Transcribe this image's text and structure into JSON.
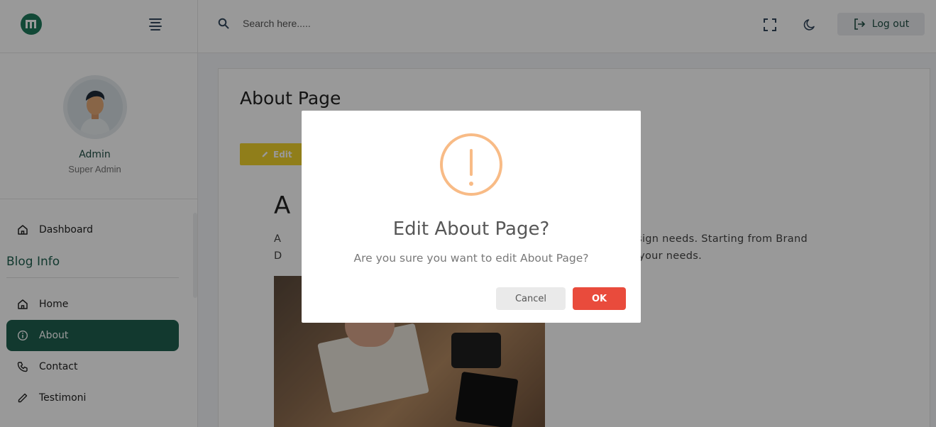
{
  "header": {
    "search_placeholder": "Search here.....",
    "logout_label": "Log out"
  },
  "sidebar": {
    "user_name": "Admin",
    "user_role": "Super Admin",
    "dashboard_label": "Dashboard",
    "section_title": "Blog Info",
    "items": [
      {
        "label": "Home",
        "icon": "home-icon"
      },
      {
        "label": "About",
        "icon": "info-icon",
        "active": true
      },
      {
        "label": "Contact",
        "icon": "phone-icon"
      },
      {
        "label": "Testimoni",
        "icon": "pencil-icon"
      }
    ]
  },
  "main": {
    "page_title": "About Page",
    "edit_button_label": "Edit",
    "about_title": "A",
    "about_text_line1_start": "A",
    "about_text_line1_end": "r design needs. Starting from Brand",
    "about_text_line2_start": "D",
    "about_text_line2_end": "g to your needs."
  },
  "modal": {
    "title": "Edit About Page?",
    "message": "Are you sure you want to edit About Page?",
    "cancel_label": "Cancel",
    "ok_label": "OK"
  },
  "colors": {
    "accent": "#1f5f4f",
    "warning": "#f8bb86",
    "confirm": "#e94b3c",
    "edit_button": "#f0d22c"
  }
}
